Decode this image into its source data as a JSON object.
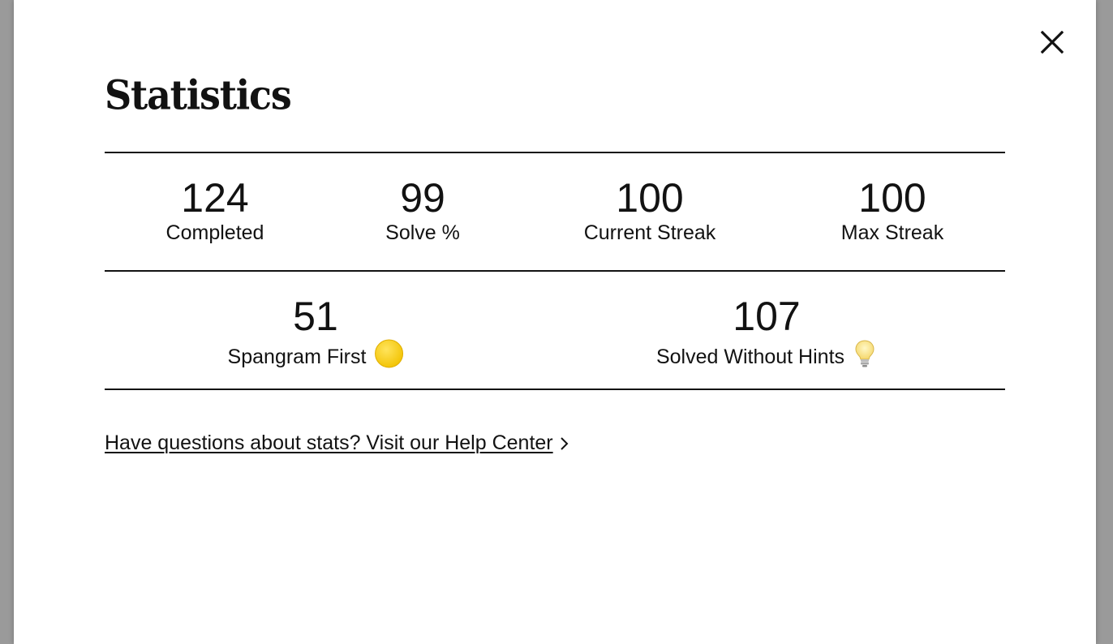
{
  "modal": {
    "title": "Statistics",
    "close_icon": "close-icon"
  },
  "stats_row_1": [
    {
      "value": "124",
      "label": "Completed"
    },
    {
      "value": "99",
      "label": "Solve %"
    },
    {
      "value": "100",
      "label": "Current Streak"
    },
    {
      "value": "100",
      "label": "Max Streak"
    }
  ],
  "stats_row_2": [
    {
      "value": "51",
      "label": "Spangram First",
      "icon": "yellow-circle-icon"
    },
    {
      "value": "107",
      "label": "Solved Without Hints",
      "icon": "lightbulb-icon"
    }
  ],
  "help": {
    "text": "Have questions about stats? Visit our Help Center",
    "icon": "chevron-right-icon"
  },
  "colors": {
    "text": "#121212",
    "spangram_yellow": "#F8CD05",
    "background": "#FFFFFF"
  }
}
